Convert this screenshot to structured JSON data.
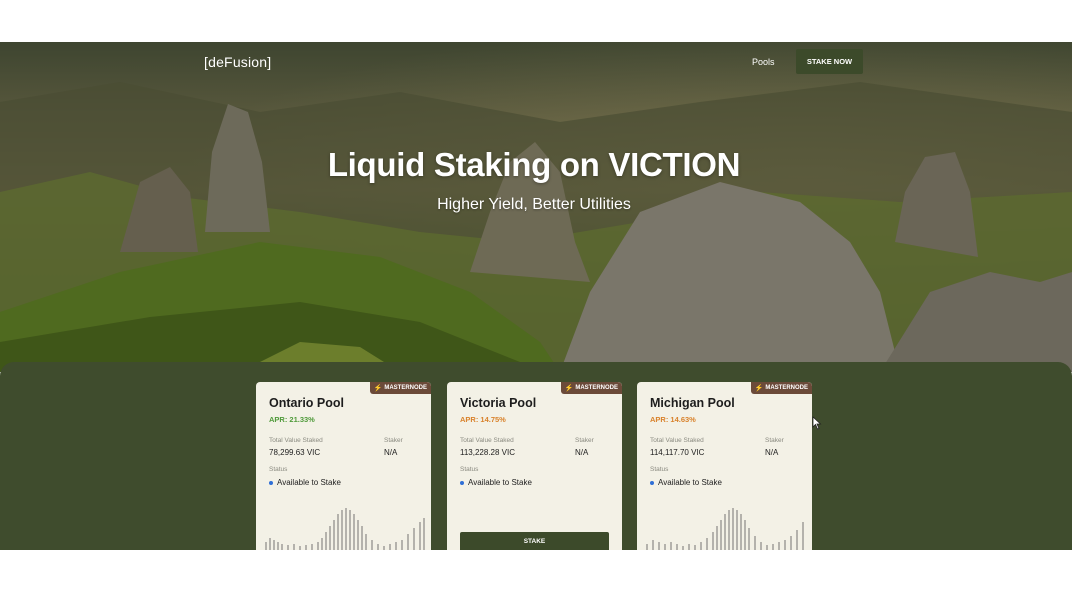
{
  "nav": {
    "logo": "[deFusion]",
    "pools_link": "Pools",
    "cta": "STAKE NOW"
  },
  "hero": {
    "title": "Liquid Staking on VICTION",
    "subtitle": "Higher Yield, Better Utilities"
  },
  "pool_labels": {
    "tvs": "Total Value Staked",
    "staker": "Staker",
    "status": "Status"
  },
  "pools": [
    {
      "badge": "MASTERNODE",
      "name": "Ontario Pool",
      "apr": "APR: 21.33%",
      "apr_color": "#4f9a3a",
      "tvs": "78,299.63 VIC",
      "staker": "N/A",
      "status": "Available to Stake"
    },
    {
      "badge": "MASTERNODE",
      "name": "Victoria Pool",
      "apr": "APR: 14.75%",
      "apr_color": "#d9822b",
      "tvs": "113,228.28 VIC",
      "staker": "N/A",
      "status": "Available to Stake",
      "button": "STAKE"
    },
    {
      "badge": "MASTERNODE",
      "name": "Michigan Pool",
      "apr": "APR: 14.63%",
      "apr_color": "#d9822b",
      "tvs": "114,117.70 VIC",
      "staker": "N/A",
      "status": "Available to Stake"
    }
  ],
  "colors": {
    "panel": "#3f4c2d",
    "card": "#f3f1e6",
    "badge": "#6b4a39",
    "button": "#3c4a2a",
    "status_dot": "#2f6fd6"
  }
}
